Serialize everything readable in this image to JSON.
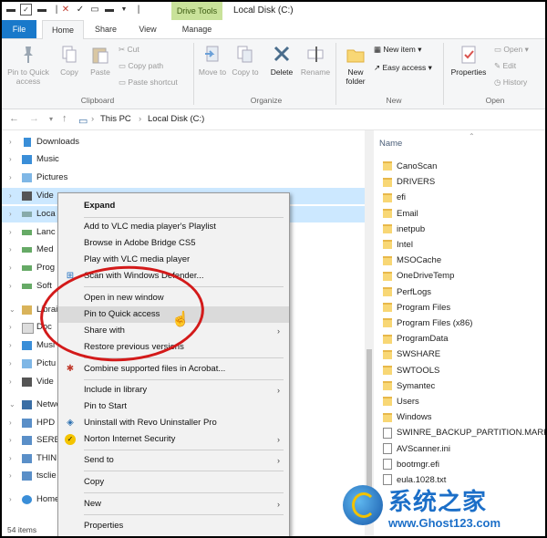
{
  "window": {
    "contextual_tab": "Drive Tools",
    "title": "Local Disk (C:)"
  },
  "ribbon_tabs": {
    "file": "File",
    "home": "Home",
    "share": "Share",
    "view": "View",
    "manage": "Manage"
  },
  "ribbon": {
    "pin": "Pin to Quick access",
    "copy": "Copy",
    "paste": "Paste",
    "cut": "Cut",
    "copy_path": "Copy path",
    "paste_shortcut": "Paste shortcut",
    "clipboard_group": "Clipboard",
    "move_to": "Move to",
    "copy_to": "Copy to",
    "delete": "Delete",
    "rename": "Rename",
    "organize_group": "Organize",
    "new_folder": "New folder",
    "new_item": "New item",
    "easy_access": "Easy access",
    "new_group": "New",
    "properties": "Properties",
    "open": "Open",
    "edit": "Edit",
    "history": "History",
    "open_group": "Open"
  },
  "address": {
    "crumb1": "This PC",
    "crumb2": "Local Disk (C:)"
  },
  "nav": {
    "items": [
      {
        "label": "Downloads"
      },
      {
        "label": "Music"
      },
      {
        "label": "Pictures"
      },
      {
        "label": "Vide"
      },
      {
        "label": "Loca"
      },
      {
        "label": "Lanc"
      },
      {
        "label": "Med"
      },
      {
        "label": "Prog"
      },
      {
        "label": "Soft"
      },
      {
        "label": "Librai"
      },
      {
        "label": "Doc"
      },
      {
        "label": "Musi"
      },
      {
        "label": "Pictu"
      },
      {
        "label": "Vide"
      },
      {
        "label": "Netwo"
      },
      {
        "label": "HPD"
      },
      {
        "label": "SERE"
      },
      {
        "label": "THIN"
      },
      {
        "label": "tsclie"
      },
      {
        "label": "Home"
      }
    ]
  },
  "status": "54 items",
  "filelist": {
    "name_header": "Name",
    "files": [
      {
        "name": "CanoScan",
        "type": "folder"
      },
      {
        "name": "DRIVERS",
        "type": "folder"
      },
      {
        "name": "efi",
        "type": "folder"
      },
      {
        "name": "Email",
        "type": "folder"
      },
      {
        "name": "inetpub",
        "type": "folder"
      },
      {
        "name": "Intel",
        "type": "folder"
      },
      {
        "name": "MSOCache",
        "type": "folder"
      },
      {
        "name": "OneDriveTemp",
        "type": "folder"
      },
      {
        "name": "PerfLogs",
        "type": "folder"
      },
      {
        "name": "Program Files",
        "type": "folder"
      },
      {
        "name": "Program Files (x86)",
        "type": "folder"
      },
      {
        "name": "ProgramData",
        "type": "folder"
      },
      {
        "name": "SWSHARE",
        "type": "folder"
      },
      {
        "name": "SWTOOLS",
        "type": "folder"
      },
      {
        "name": "Symantec",
        "type": "folder"
      },
      {
        "name": "Users",
        "type": "folder"
      },
      {
        "name": "Windows",
        "type": "folder"
      },
      {
        "name": "SWINRE_BACKUP_PARTITION.MARKER",
        "type": "file"
      },
      {
        "name": "AVScanner.ini",
        "type": "file"
      },
      {
        "name": "bootmgr.efi",
        "type": "file"
      },
      {
        "name": "eula.1028.txt",
        "type": "file"
      }
    ]
  },
  "context_menu": {
    "expand": "Expand",
    "vlc_playlist": "Add to VLC media player's Playlist",
    "bridge": "Browse in Adobe Bridge CS5",
    "vlc_play": "Play with VLC media player",
    "defender": "Scan with Windows Defender...",
    "new_window": "Open in new window",
    "pin_quick": "Pin to Quick access",
    "share_with": "Share with",
    "restore": "Restore previous versions",
    "acrobat": "Combine supported files in Acrobat...",
    "include_library": "Include in library",
    "pin_start": "Pin to Start",
    "revo": "Uninstall with Revo Uninstaller Pro",
    "norton": "Norton Internet Security",
    "send_to": "Send to",
    "copy": "Copy",
    "new": "New",
    "properties": "Properties"
  },
  "watermark": {
    "cn": "系统之家",
    "url": "www.Ghost123.com"
  },
  "colors": {
    "accent": "#1979ca",
    "selection": "#cce8ff",
    "annotation": "#d31a1a"
  }
}
